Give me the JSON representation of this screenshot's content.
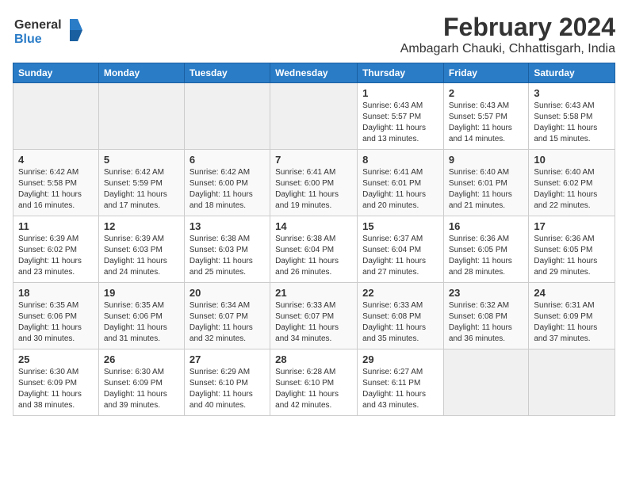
{
  "logo": {
    "general": "General",
    "blue": "Blue"
  },
  "title": "February 2024",
  "subtitle": "Ambagarh Chauki, Chhattisgarh, India",
  "days_of_week": [
    "Sunday",
    "Monday",
    "Tuesday",
    "Wednesday",
    "Thursday",
    "Friday",
    "Saturday"
  ],
  "weeks": [
    [
      {
        "day": "",
        "info": ""
      },
      {
        "day": "",
        "info": ""
      },
      {
        "day": "",
        "info": ""
      },
      {
        "day": "",
        "info": ""
      },
      {
        "day": "1",
        "info": "Sunrise: 6:43 AM\nSunset: 5:57 PM\nDaylight: 11 hours and 13 minutes."
      },
      {
        "day": "2",
        "info": "Sunrise: 6:43 AM\nSunset: 5:57 PM\nDaylight: 11 hours and 14 minutes."
      },
      {
        "day": "3",
        "info": "Sunrise: 6:43 AM\nSunset: 5:58 PM\nDaylight: 11 hours and 15 minutes."
      }
    ],
    [
      {
        "day": "4",
        "info": "Sunrise: 6:42 AM\nSunset: 5:58 PM\nDaylight: 11 hours and 16 minutes."
      },
      {
        "day": "5",
        "info": "Sunrise: 6:42 AM\nSunset: 5:59 PM\nDaylight: 11 hours and 17 minutes."
      },
      {
        "day": "6",
        "info": "Sunrise: 6:42 AM\nSunset: 6:00 PM\nDaylight: 11 hours and 18 minutes."
      },
      {
        "day": "7",
        "info": "Sunrise: 6:41 AM\nSunset: 6:00 PM\nDaylight: 11 hours and 19 minutes."
      },
      {
        "day": "8",
        "info": "Sunrise: 6:41 AM\nSunset: 6:01 PM\nDaylight: 11 hours and 20 minutes."
      },
      {
        "day": "9",
        "info": "Sunrise: 6:40 AM\nSunset: 6:01 PM\nDaylight: 11 hours and 21 minutes."
      },
      {
        "day": "10",
        "info": "Sunrise: 6:40 AM\nSunset: 6:02 PM\nDaylight: 11 hours and 22 minutes."
      }
    ],
    [
      {
        "day": "11",
        "info": "Sunrise: 6:39 AM\nSunset: 6:02 PM\nDaylight: 11 hours and 23 minutes."
      },
      {
        "day": "12",
        "info": "Sunrise: 6:39 AM\nSunset: 6:03 PM\nDaylight: 11 hours and 24 minutes."
      },
      {
        "day": "13",
        "info": "Sunrise: 6:38 AM\nSunset: 6:03 PM\nDaylight: 11 hours and 25 minutes."
      },
      {
        "day": "14",
        "info": "Sunrise: 6:38 AM\nSunset: 6:04 PM\nDaylight: 11 hours and 26 minutes."
      },
      {
        "day": "15",
        "info": "Sunrise: 6:37 AM\nSunset: 6:04 PM\nDaylight: 11 hours and 27 minutes."
      },
      {
        "day": "16",
        "info": "Sunrise: 6:36 AM\nSunset: 6:05 PM\nDaylight: 11 hours and 28 minutes."
      },
      {
        "day": "17",
        "info": "Sunrise: 6:36 AM\nSunset: 6:05 PM\nDaylight: 11 hours and 29 minutes."
      }
    ],
    [
      {
        "day": "18",
        "info": "Sunrise: 6:35 AM\nSunset: 6:06 PM\nDaylight: 11 hours and 30 minutes."
      },
      {
        "day": "19",
        "info": "Sunrise: 6:35 AM\nSunset: 6:06 PM\nDaylight: 11 hours and 31 minutes."
      },
      {
        "day": "20",
        "info": "Sunrise: 6:34 AM\nSunset: 6:07 PM\nDaylight: 11 hours and 32 minutes."
      },
      {
        "day": "21",
        "info": "Sunrise: 6:33 AM\nSunset: 6:07 PM\nDaylight: 11 hours and 34 minutes."
      },
      {
        "day": "22",
        "info": "Sunrise: 6:33 AM\nSunset: 6:08 PM\nDaylight: 11 hours and 35 minutes."
      },
      {
        "day": "23",
        "info": "Sunrise: 6:32 AM\nSunset: 6:08 PM\nDaylight: 11 hours and 36 minutes."
      },
      {
        "day": "24",
        "info": "Sunrise: 6:31 AM\nSunset: 6:09 PM\nDaylight: 11 hours and 37 minutes."
      }
    ],
    [
      {
        "day": "25",
        "info": "Sunrise: 6:30 AM\nSunset: 6:09 PM\nDaylight: 11 hours and 38 minutes."
      },
      {
        "day": "26",
        "info": "Sunrise: 6:30 AM\nSunset: 6:09 PM\nDaylight: 11 hours and 39 minutes."
      },
      {
        "day": "27",
        "info": "Sunrise: 6:29 AM\nSunset: 6:10 PM\nDaylight: 11 hours and 40 minutes."
      },
      {
        "day": "28",
        "info": "Sunrise: 6:28 AM\nSunset: 6:10 PM\nDaylight: 11 hours and 42 minutes."
      },
      {
        "day": "29",
        "info": "Sunrise: 6:27 AM\nSunset: 6:11 PM\nDaylight: 11 hours and 43 minutes."
      },
      {
        "day": "",
        "info": ""
      },
      {
        "day": "",
        "info": ""
      }
    ]
  ]
}
